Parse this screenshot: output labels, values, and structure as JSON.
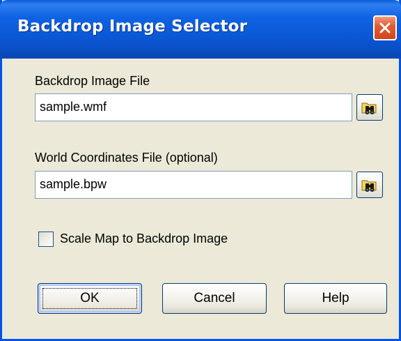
{
  "window": {
    "title": "Backdrop Image Selector"
  },
  "image_file": {
    "label": "Backdrop Image File",
    "value": "sample.wmf"
  },
  "world_file": {
    "label": "World Coordinates File (optional)",
    "value": "sample.bpw"
  },
  "scale_option": {
    "label": "Scale Map to Backdrop Image",
    "checked": false
  },
  "buttons": {
    "ok": "OK",
    "cancel": "Cancel",
    "help": "Help"
  },
  "icons": {
    "close": "close-icon",
    "browse": "binoculars-folder-icon"
  },
  "colors": {
    "titlebar": "#0b58d6",
    "face": "#ece9d8",
    "close": "#e35d33"
  }
}
